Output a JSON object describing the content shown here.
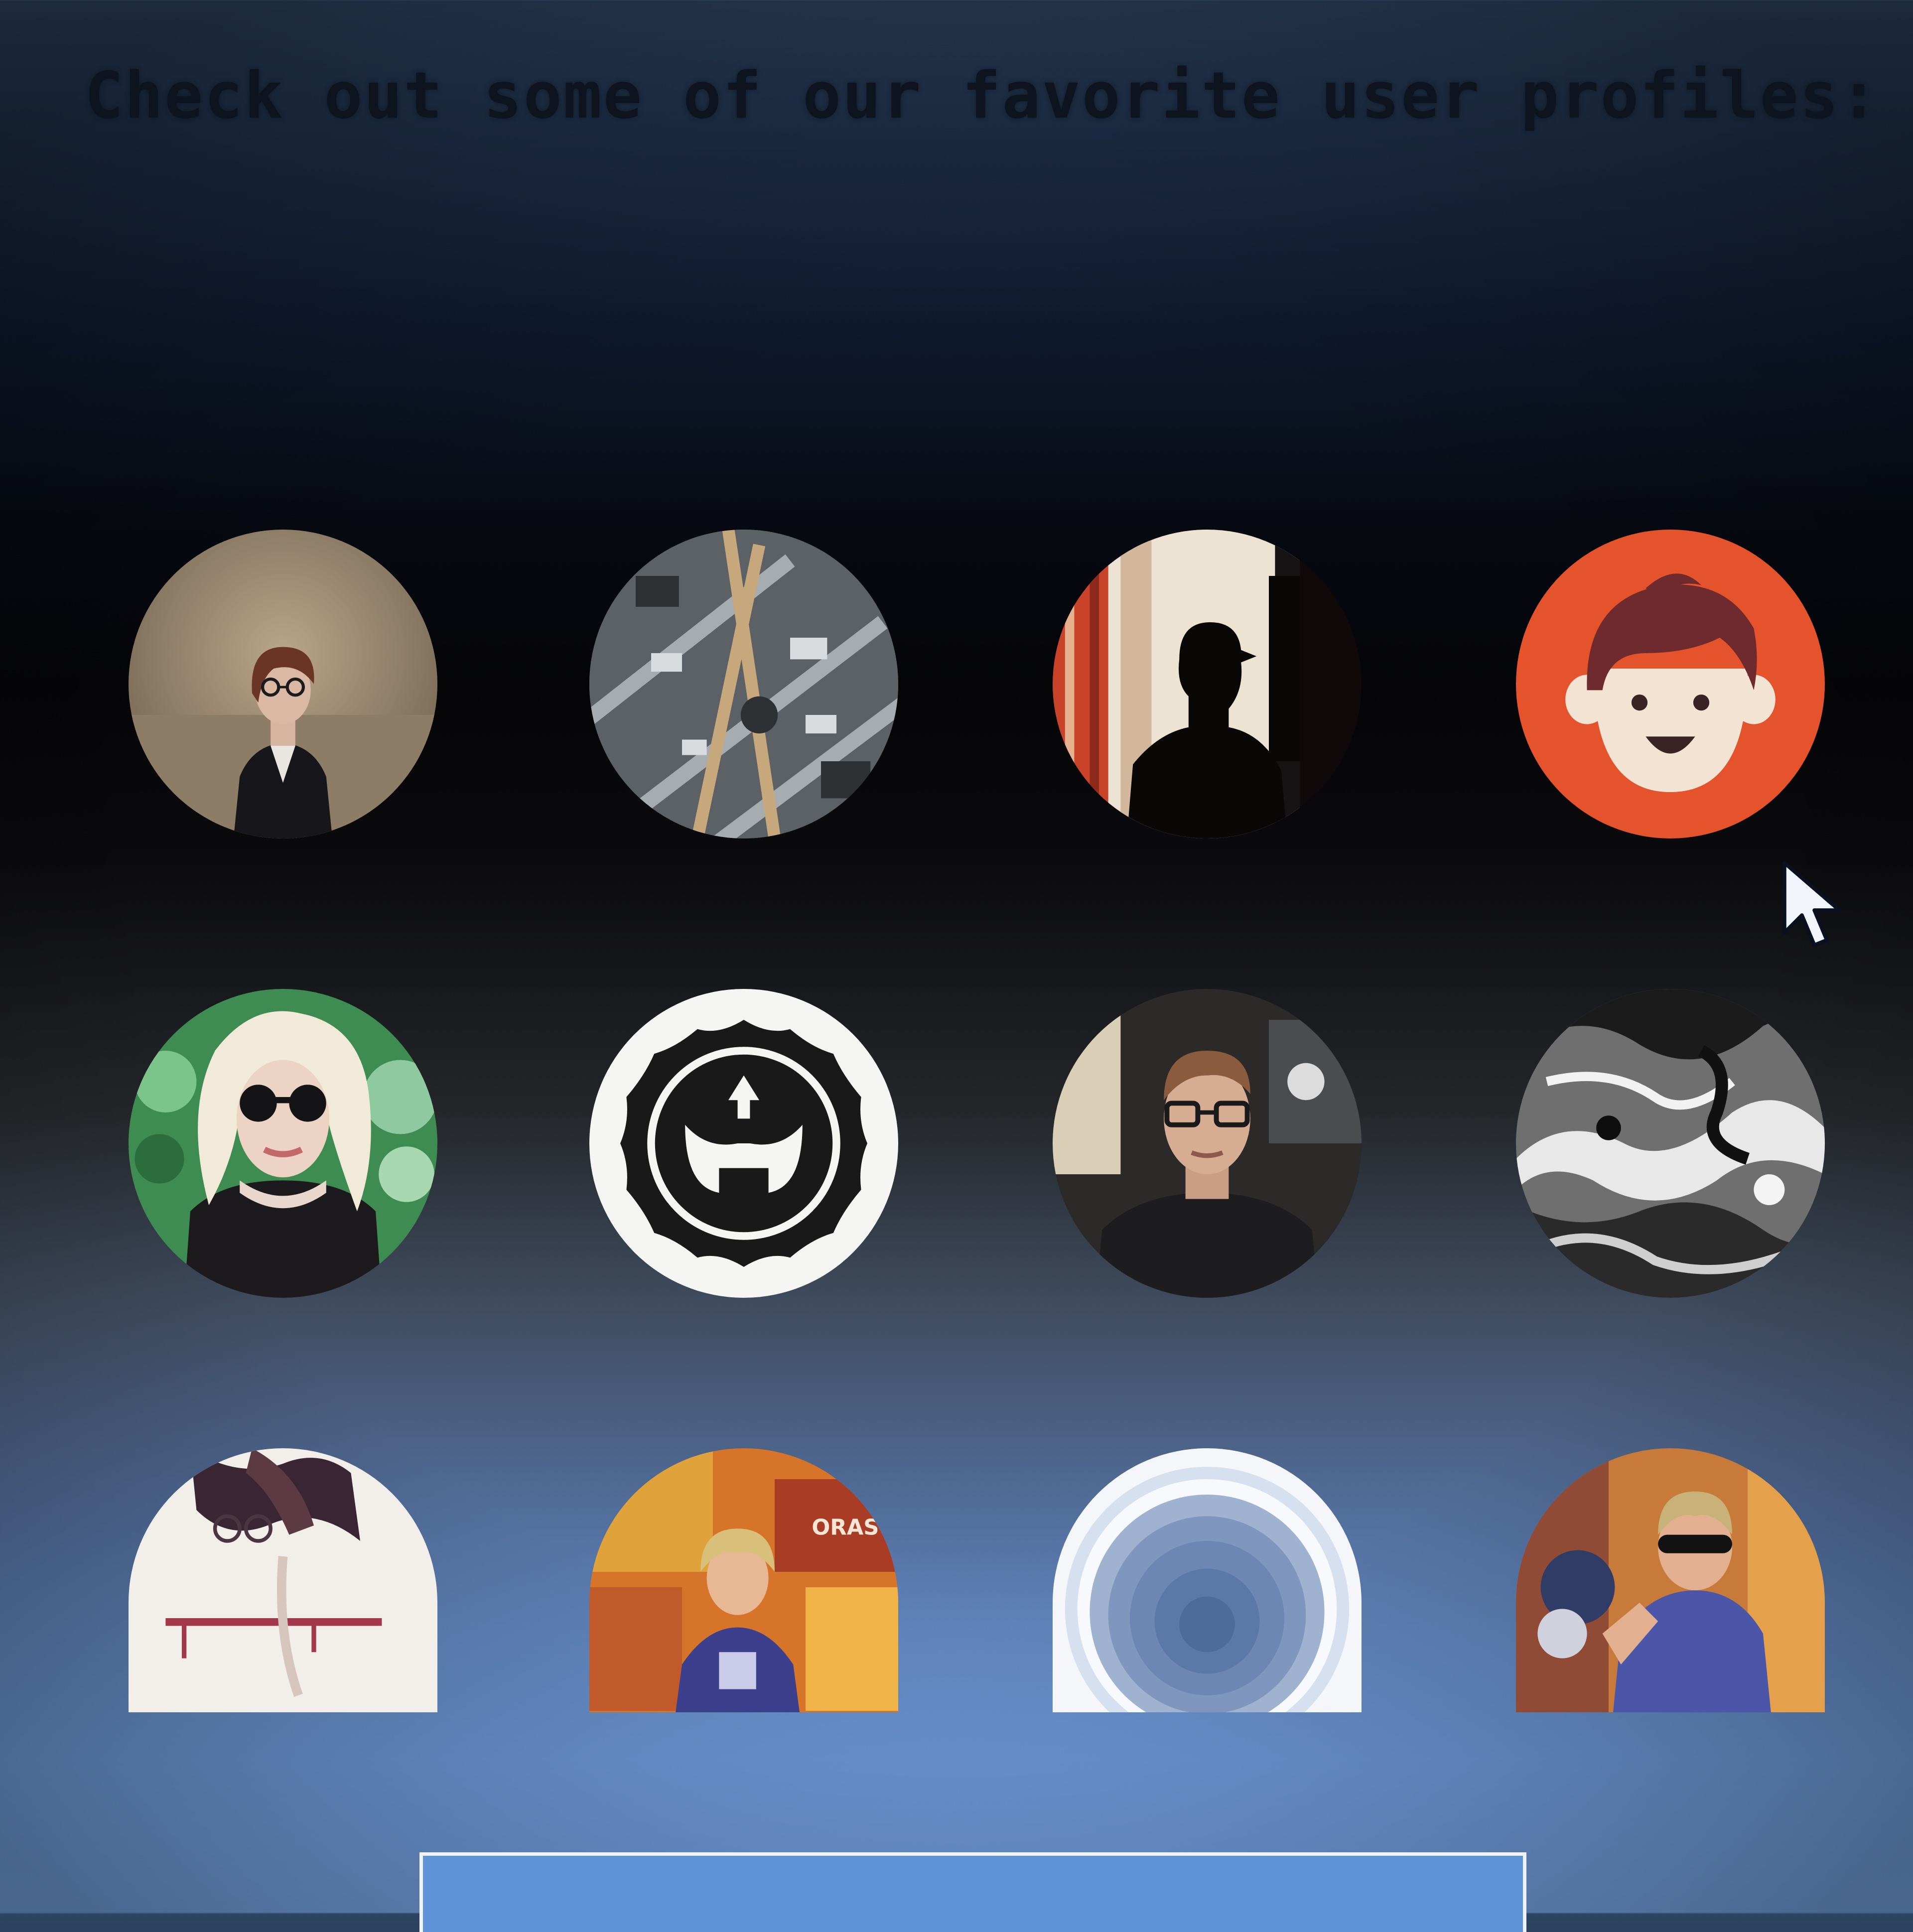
{
  "heading": "Check out some of our favorite user profiles:",
  "profiles": [
    {
      "name": "profile-avatar-1",
      "icon": "woman-glasses-photo"
    },
    {
      "name": "profile-avatar-2",
      "icon": "metal-structure-photo"
    },
    {
      "name": "profile-avatar-3",
      "icon": "silhouette-photo"
    },
    {
      "name": "profile-avatar-4",
      "icon": "cartoon-boy-face-icon"
    },
    {
      "name": "profile-avatar-5",
      "icon": "woman-sunglasses-photo"
    },
    {
      "name": "profile-avatar-6",
      "icon": "crown-emblem-icon"
    },
    {
      "name": "profile-avatar-7",
      "icon": "man-glasses-photo"
    },
    {
      "name": "profile-avatar-8",
      "icon": "monochrome-texture-photo"
    },
    {
      "name": "profile-avatar-9",
      "icon": "person-white-shirt-photo"
    },
    {
      "name": "profile-avatar-10",
      "icon": "colorful-poster-photo"
    },
    {
      "name": "profile-avatar-11",
      "icon": "concentric-rings-icon"
    },
    {
      "name": "profile-avatar-12",
      "icon": "man-sunglasses-photo"
    }
  ],
  "colors": {
    "accent_orange": "#e5532c",
    "heading_text": "#0d1420",
    "box_fill": "#5f93d8",
    "box_border": "#eef3fb"
  }
}
